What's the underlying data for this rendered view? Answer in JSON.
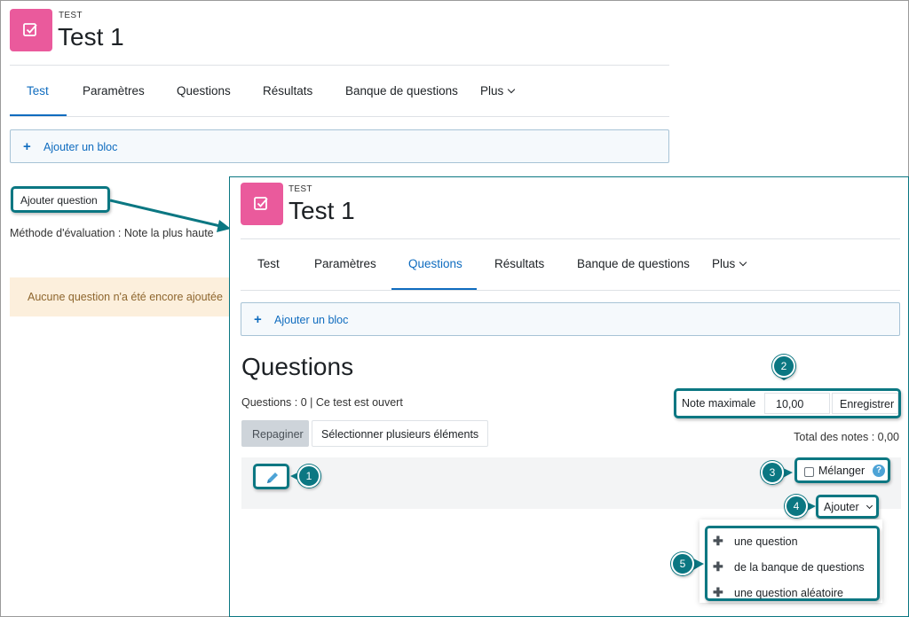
{
  "back": {
    "kicker": "TEST",
    "title": "Test 1",
    "tabs": [
      {
        "label": "Test",
        "active": true
      },
      {
        "label": "Paramètres",
        "active": false
      },
      {
        "label": "Questions",
        "active": false
      },
      {
        "label": "Résultats",
        "active": false
      },
      {
        "label": "Banque de questions",
        "active": false
      },
      {
        "label": "Plus",
        "active": false
      }
    ],
    "add_block": "Ajouter un bloc",
    "add_question": "Ajouter question",
    "method": "Méthode d'évaluation : Note la plus haute",
    "alert": "Aucune question n'a été encore ajoutée"
  },
  "front": {
    "kicker": "TEST",
    "title": "Test 1",
    "tabs": [
      {
        "label": "Test",
        "active": false
      },
      {
        "label": "Paramètres",
        "active": false
      },
      {
        "label": "Questions",
        "active": true
      },
      {
        "label": "Résultats",
        "active": false
      },
      {
        "label": "Banque de questions",
        "active": false
      },
      {
        "label": "Plus",
        "active": false
      }
    ],
    "add_block": "Ajouter un bloc",
    "heading": "Questions",
    "summary": "Questions : 0 | Ce test est ouvert",
    "repaginate": "Repaginer",
    "select_multiple": "Sélectionner plusieurs éléments",
    "max_grade_label": "Note maximale",
    "max_grade_value": "10,00",
    "save": "Enregistrer",
    "total": "Total des notes : 0,00",
    "shuffle": "Mélanger",
    "help": "?",
    "add": "Ajouter",
    "menu": [
      "une question",
      "de la banque de questions",
      "une question aléatoire"
    ]
  },
  "markers": [
    "1",
    "2",
    "3",
    "4",
    "5"
  ],
  "colors": {
    "accent_teal": "#0b7782",
    "icon_pink": "#ea5a9c",
    "link_blue": "#0f6cbf",
    "alert_bg": "#fcefdc"
  },
  "icons": {
    "activity": "checkbox-edit-icon",
    "edit": "pencil-icon",
    "help": "question-circle-icon",
    "plus": "plus-icon",
    "dropdown": "chevron-down-icon"
  }
}
